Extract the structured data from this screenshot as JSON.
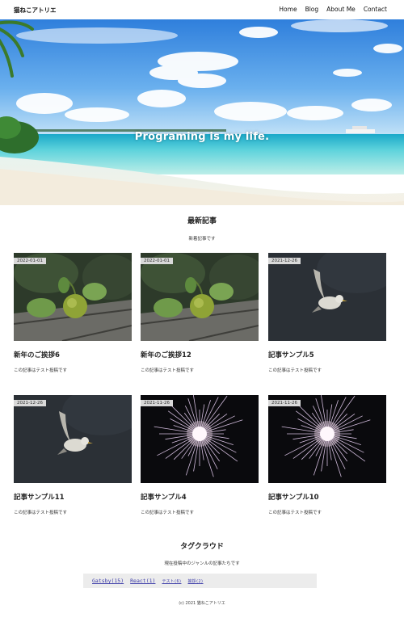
{
  "header": {
    "brand": "猫ねこアトリエ",
    "nav": [
      "Home",
      "Blog",
      "About Me",
      "Contact"
    ]
  },
  "hero": {
    "title": "Programing is my life."
  },
  "latest": {
    "heading": "最新記事",
    "subheading": "新着記事です",
    "cards": [
      {
        "date": "2022-01-01",
        "title": "新年のご挨拶6",
        "desc": "この記事はテスト投稿です",
        "image": "fruit"
      },
      {
        "date": "2022-01-01",
        "title": "新年のご挨拶12",
        "desc": "この記事はテスト投稿です",
        "image": "fruit"
      },
      {
        "date": "2021-12-26",
        "title": "記事サンプル5",
        "desc": "この記事はテスト投稿です",
        "image": "bird"
      },
      {
        "date": "2021-12-26",
        "title": "記事サンプル11",
        "desc": "この記事はテスト投稿です",
        "image": "bird"
      },
      {
        "date": "2021-11-26",
        "title": "記事サンプル4",
        "desc": "この記事はテスト投稿です",
        "image": "sparkler"
      },
      {
        "date": "2021-11-26",
        "title": "記事サンプル10",
        "desc": "この記事はテスト投稿です",
        "image": "sparkler"
      }
    ]
  },
  "tags": {
    "heading": "タグクラウド",
    "subheading": "現在投稿中のジャンルの記事たちです",
    "items": [
      "Gatsby(15)",
      "React(1)",
      "テスト(6)",
      "挨拶(2)"
    ]
  },
  "footer": {
    "text": "(c) 2021 猫ねこアトリエ"
  },
  "colors": {
    "sky": "#4a8fe0",
    "sea": "#3fc3d8",
    "tag_link": "#3a3aa8",
    "badge": "#d9d9d9"
  }
}
